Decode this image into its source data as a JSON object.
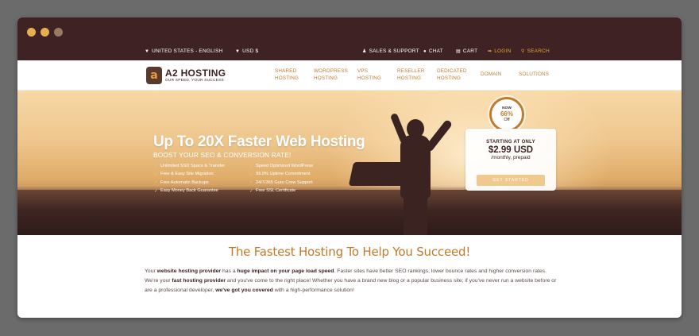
{
  "window": {
    "dots": [
      "red",
      "yellow",
      "green"
    ]
  },
  "topbar": {
    "region": "UNITED STATES - ENGLISH",
    "currency": "USD $",
    "sales_support": "SALES & SUPPORT",
    "chat": "CHAT",
    "cart": "CART",
    "login": "LOGIN",
    "search": "SEARCH"
  },
  "brand": {
    "name": "A2 HOSTING",
    "tagline": "OUR SPEED, YOUR SUCCESS",
    "mark": "a"
  },
  "nav": {
    "items": [
      {
        "label": "SHARED\nHOSTING"
      },
      {
        "label": "WORDPRESS\nHOSTING"
      },
      {
        "label": "VPS\nHOSTING"
      },
      {
        "label": "RESELLER\nHOSTING"
      },
      {
        "label": "DEDICATED\nHOSTING"
      },
      {
        "label": "DOMAIN"
      },
      {
        "label": "SOLUTIONS"
      }
    ]
  },
  "hero": {
    "title": "Up To 20X Faster Web Hosting",
    "subtitle": "BOOST YOUR SEO & CONVERSION RATE!",
    "features": [
      "Unlimited SSD Space & Transfer",
      "Speed Optimized WordPress",
      "Free & Easy Site Migration",
      "99.9% Uptime Commitment",
      "Free Automatic Backups",
      "24/7/365 Guru Crew Support",
      "Easy Money Back Guarantee",
      "Free SSL Certificate"
    ],
    "badge": {
      "now": "NOW",
      "percent": "66%",
      "off": "Off"
    },
    "price": {
      "label": "STARTING AT ONLY",
      "value": "$2.99 USD",
      "period": "/monthly, prepaid",
      "button": "GET STARTED"
    }
  },
  "content": {
    "title": "The Fastest Hosting To Help You Succeed!",
    "paragraph": [
      {
        "text": "Your ",
        "bold": false
      },
      {
        "text": "website hosting provider",
        "bold": true
      },
      {
        "text": " has a ",
        "bold": false
      },
      {
        "text": "huge impact on your page load speed",
        "bold": true
      },
      {
        "text": ". Faster sites have better SEO rankings, lower bounce rates and higher conversion rates. We're your ",
        "bold": false
      },
      {
        "text": "fast hosting provider",
        "bold": true
      },
      {
        "text": " and you've come to the right place! Whether you have a brand new blog or a popular business site; if you've never run a website before or are a professional developer, ",
        "bold": false
      },
      {
        "text": "we've got you covered",
        "bold": true
      },
      {
        "text": " with a high-performance solution!",
        "bold": false
      }
    ]
  },
  "colors": {
    "brand_dark": "#3e2224",
    "accent": "#c27a2c",
    "accent_light": "#e6a13a"
  }
}
